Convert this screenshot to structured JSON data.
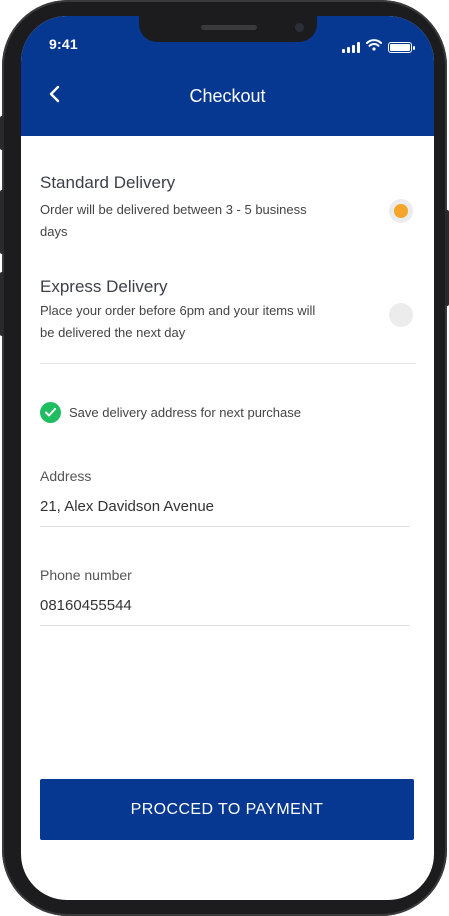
{
  "status_bar": {
    "time": "9:41"
  },
  "header": {
    "title": "Checkout"
  },
  "delivery_options": [
    {
      "title": "Standard Delivery",
      "description": "Order will be delivered between 3 - 5 business days",
      "selected": true
    },
    {
      "title": "Express Delivery",
      "description": "Place your order before 6pm and your items will be delivered the next day",
      "selected": false
    }
  ],
  "save_address": {
    "label": "Save delivery address for next purchase",
    "checked": true
  },
  "address": {
    "label": "Address",
    "value": "21, Alex Davidson Avenue"
  },
  "phone": {
    "label": "Phone number",
    "value": "08160455544"
  },
  "actions": {
    "proceed_label": "PROCCED TO PAYMENT"
  },
  "colors": {
    "primary": "#063892",
    "radio_selected": "#f5a52a",
    "check": "#1fbc62"
  }
}
